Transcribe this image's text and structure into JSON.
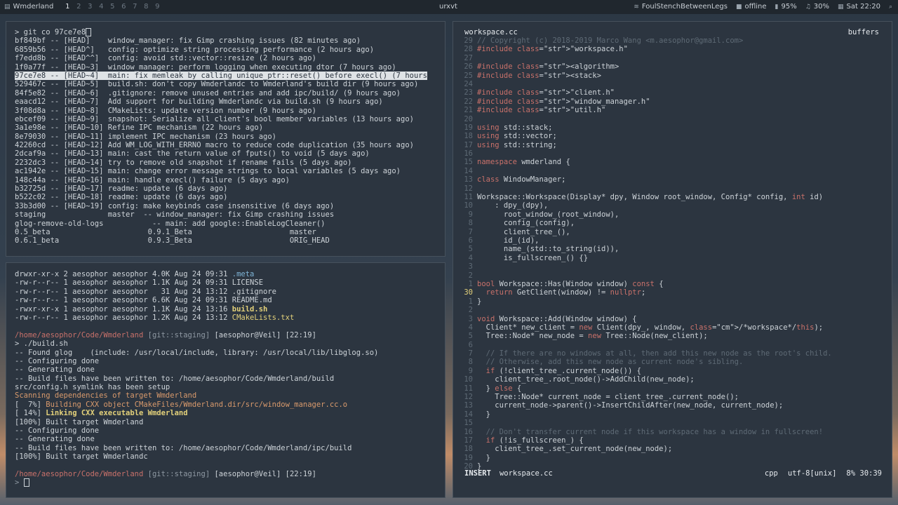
{
  "statusbar": {
    "wm_name": "Wmderland",
    "workspaces": [
      "1",
      "2",
      "3",
      "4",
      "5",
      "6",
      "7",
      "8",
      "9"
    ],
    "active_workspace": "1",
    "window_title": "urxvt",
    "wifi": "FoulStenchBetweenLegs",
    "net": "offline",
    "battery": "95%",
    "volume": "30%",
    "clock": "Sat 22:20"
  },
  "git_pane": {
    "prompt": "> git co 97ce7e8",
    "log": [
      {
        "hash": "bf849bf",
        "ref": "-- [HEAD]   ",
        "msg": "window_manager: fix Gimp crashing issues (82 minutes ago)"
      },
      {
        "hash": "6859b56",
        "ref": "-- [HEAD^]  ",
        "msg": "config: optimize string processing performance (2 hours ago)"
      },
      {
        "hash": "f7edd8b",
        "ref": "-- [HEAD^^] ",
        "msg": "config: avoid std::vector::resize (2 hours ago)"
      },
      {
        "hash": "1f0a77f",
        "ref": "-- [HEAD~3] ",
        "msg": "window_manager: perform logging when executing dtor (7 hours ago)"
      },
      {
        "hash": "97ce7e8",
        "ref": "-- [HEAD~4] ",
        "msg": "main: fix memleak by calling unique_ptr::reset() before execl() (7 hours"
      },
      {
        "hash": "529467c",
        "ref": "-- [HEAD~5] ",
        "msg": "build.sh: don't copy Wmderlandc to Wmderland's build dir (9 hours ago)"
      },
      {
        "hash": "84f5e82",
        "ref": "-- [HEAD~6] ",
        "msg": ".gitignore: remove unused entries and add ipc/build/ (9 hours ago)"
      },
      {
        "hash": "eaacd12",
        "ref": "-- [HEAD~7] ",
        "msg": "Add support for building Wmderlandc via build.sh (9 hours ago)"
      },
      {
        "hash": "3f08d8a",
        "ref": "-- [HEAD~8] ",
        "msg": "CMakeLists: update version number (9 hours ago)"
      },
      {
        "hash": "ebcef09",
        "ref": "-- [HEAD~9] ",
        "msg": "snapshot: Serialize all client's bool member variables (13 hours ago)"
      },
      {
        "hash": "3a1e98e",
        "ref": "-- [HEAD~10]",
        "msg": "Refine IPC mechanism (22 hours ago)"
      },
      {
        "hash": "8e79030",
        "ref": "-- [HEAD~11]",
        "msg": "implement IPC mechanism (23 hours ago)"
      },
      {
        "hash": "42260cd",
        "ref": "-- [HEAD~12]",
        "msg": "Add WM_LOG_WITH_ERRNO macro to reduce code duplication (35 hours ago)"
      },
      {
        "hash": "2dcaf9a",
        "ref": "-- [HEAD~13]",
        "msg": "main: cast the return value of fputs() to void (5 days ago)"
      },
      {
        "hash": "2232dc3",
        "ref": "-- [HEAD~14]",
        "msg": "try to remove old snapshot if rename fails (5 days ago)"
      },
      {
        "hash": "ac1942e",
        "ref": "-- [HEAD~15]",
        "msg": "main: change error message strings to local variables (5 days ago)"
      },
      {
        "hash": "148c44a",
        "ref": "-- [HEAD~16]",
        "msg": "main: handle execl() failure (5 days ago)"
      },
      {
        "hash": "b32725d",
        "ref": "-- [HEAD~17]",
        "msg": "readme: update (6 days ago)"
      },
      {
        "hash": "b522c02",
        "ref": "-- [HEAD~18]",
        "msg": "readme: update (6 days ago)"
      },
      {
        "hash": "33b3d00",
        "ref": "-- [HEAD~19]",
        "msg": "config: make keybinds case insensitive (6 days ago)"
      }
    ],
    "branches": [
      "staging              master  -- window_manager: fix Gimp crashing issues",
      "glog-remove-old-logs           -- main: add google::EnableLogCleaner()",
      "0.5_beta                      0.9.1_Beta                      master",
      "0.6.1_beta                    0.9.3_Beta                      ORIG_HEAD"
    ]
  },
  "build_pane": {
    "files": [
      {
        "meta": "drwxr-xr-x 2 aesophor aesophor 4.0K Aug 24 09:31 ",
        "name": ".meta",
        "kind": "dir"
      },
      {
        "meta": "-rw-r--r-- 1 aesophor aesophor 1.1K Aug 24 09:31 ",
        "name": "LICENSE",
        "kind": "file"
      },
      {
        "meta": "-rw-r--r-- 1 aesophor aesophor   31 Aug 24 13:12 ",
        "name": ".gitignore",
        "kind": "file"
      },
      {
        "meta": "-rw-r--r-- 1 aesophor aesophor 6.6K Aug 24 09:31 ",
        "name": "README.md",
        "kind": "file"
      },
      {
        "meta": "-rwxr-xr-x 1 aesophor aesophor 1.1K Aug 24 13:16 ",
        "name": "build.sh",
        "kind": "exec"
      },
      {
        "meta": "-rw-r--r-- 1 aesophor aesophor 1.2K Aug 24 13:12 ",
        "name": "CMakeLists.txt",
        "kind": "cmake"
      }
    ],
    "prompt_path": "/home/aesophor/Code/Wmderland",
    "prompt_git": " [git::staging]",
    "prompt_user": " [aesophor@Veil]",
    "prompt_time1": " [22:19]",
    "cmd": "> ./build.sh",
    "out1": "-- Found glog    (include: /usr/local/include, library: /usr/local/lib/libglog.so)",
    "out2": "-- Configuring done",
    "out3": "-- Generating done",
    "out4": "-- Build files have been written to: /home/aesophor/Code/Wmderland/build",
    "out5": "src/config.h symlink has been setup",
    "out6": "Scanning dependencies of target Wmderland",
    "out7a": "[  7%] ",
    "out7b": "Building CXX object CMakeFiles/Wmderland.dir/src/window_manager.cc.o",
    "out8a": "[ 14%] ",
    "out8b": "Linking CXX executable Wmderland",
    "out9": "[100%] Built target Wmderland",
    "out10": "-- Configuring done",
    "out11": "-- Generating done",
    "out12": "-- Build files have been written to: /home/aesophor/Code/Wmderland/ipc/build",
    "out13": "[100%] Built target Wmderlandc",
    "prompt_time2": " [22:19]",
    "final_prompt": "> "
  },
  "editor": {
    "filename": "workspace.cc",
    "buffers_label": "buffers",
    "mode": "INSERT",
    "status_file": "workspace.cc",
    "filetype": "cpp",
    "encoding": "utf-8[unix]",
    "position": "8% 30:39",
    "lines": [
      {
        "n": "29",
        "t": "// Copyright (c) 2018-2019 Marco Wang <m.aesophor@gmail.com>"
      },
      {
        "n": "28",
        "t": "#include \"workspace.h\""
      },
      {
        "n": "27",
        "t": ""
      },
      {
        "n": "26",
        "t": "#include <algorithm>"
      },
      {
        "n": "25",
        "t": "#include <stack>"
      },
      {
        "n": "24",
        "t": ""
      },
      {
        "n": "23",
        "t": "#include \"client.h\""
      },
      {
        "n": "22",
        "t": "#include \"window_manager.h\""
      },
      {
        "n": "21",
        "t": "#include \"util.h\""
      },
      {
        "n": "20",
        "t": ""
      },
      {
        "n": "19",
        "t": "using std::stack;"
      },
      {
        "n": "18",
        "t": "using std::vector;"
      },
      {
        "n": "17",
        "t": "using std::string;"
      },
      {
        "n": "16",
        "t": ""
      },
      {
        "n": "15",
        "t": "namespace wmderland {"
      },
      {
        "n": "14",
        "t": ""
      },
      {
        "n": "13",
        "t": "class WindowManager;"
      },
      {
        "n": "12",
        "t": ""
      },
      {
        "n": "11",
        "t": "Workspace::Workspace(Display* dpy, Window root_window, Config* config, int id)"
      },
      {
        "n": "10",
        "t": "    : dpy_(dpy),"
      },
      {
        "n": "9",
        "t": "      root_window_(root_window),"
      },
      {
        "n": "8",
        "t": "      config_(config),"
      },
      {
        "n": "7",
        "t": "      client_tree_(),"
      },
      {
        "n": "6",
        "t": "      id_(id),"
      },
      {
        "n": "5",
        "t": "      name_(std::to_string(id)),"
      },
      {
        "n": "4",
        "t": "      is_fullscreen_() {}"
      },
      {
        "n": "3",
        "t": ""
      },
      {
        "n": "2",
        "t": ""
      },
      {
        "n": "1",
        "t": "bool Workspace::Has(Window window) const {"
      },
      {
        "n": "30",
        "t": "  return GetClient(window) != nullptr;"
      },
      {
        "n": "1",
        "t": "}"
      },
      {
        "n": "2",
        "t": ""
      },
      {
        "n": "3",
        "t": "void Workspace::Add(Window window) {"
      },
      {
        "n": "4",
        "t": "  Client* new_client = new Client(dpy_, window, /*workspace*/this);"
      },
      {
        "n": "5",
        "t": "  Tree::Node* new_node = new Tree::Node(new_client);"
      },
      {
        "n": "6",
        "t": ""
      },
      {
        "n": "7",
        "t": "  // If there are no windows at all, then add this new node as the root's child."
      },
      {
        "n": "8",
        "t": "  // Otherwise, add this new node as current node's sibling."
      },
      {
        "n": "9",
        "t": "  if (!client_tree_.current_node()) {"
      },
      {
        "n": "10",
        "t": "    client_tree_.root_node()->AddChild(new_node);"
      },
      {
        "n": "11",
        "t": "  } else {"
      },
      {
        "n": "12",
        "t": "    Tree::Node* current_node = client_tree_.current_node();"
      },
      {
        "n": "13",
        "t": "    current_node->parent()->InsertChildAfter(new_node, current_node);"
      },
      {
        "n": "14",
        "t": "  }"
      },
      {
        "n": "15",
        "t": ""
      },
      {
        "n": "16",
        "t": "  // Don't transfer current node if this workspace has a window in fullscreen!"
      },
      {
        "n": "17",
        "t": "  if (!is_fullscreen_) {"
      },
      {
        "n": "18",
        "t": "    client_tree_.set_current_node(new_node);"
      },
      {
        "n": "19",
        "t": "  }"
      },
      {
        "n": "20",
        "t": "}"
      }
    ]
  }
}
